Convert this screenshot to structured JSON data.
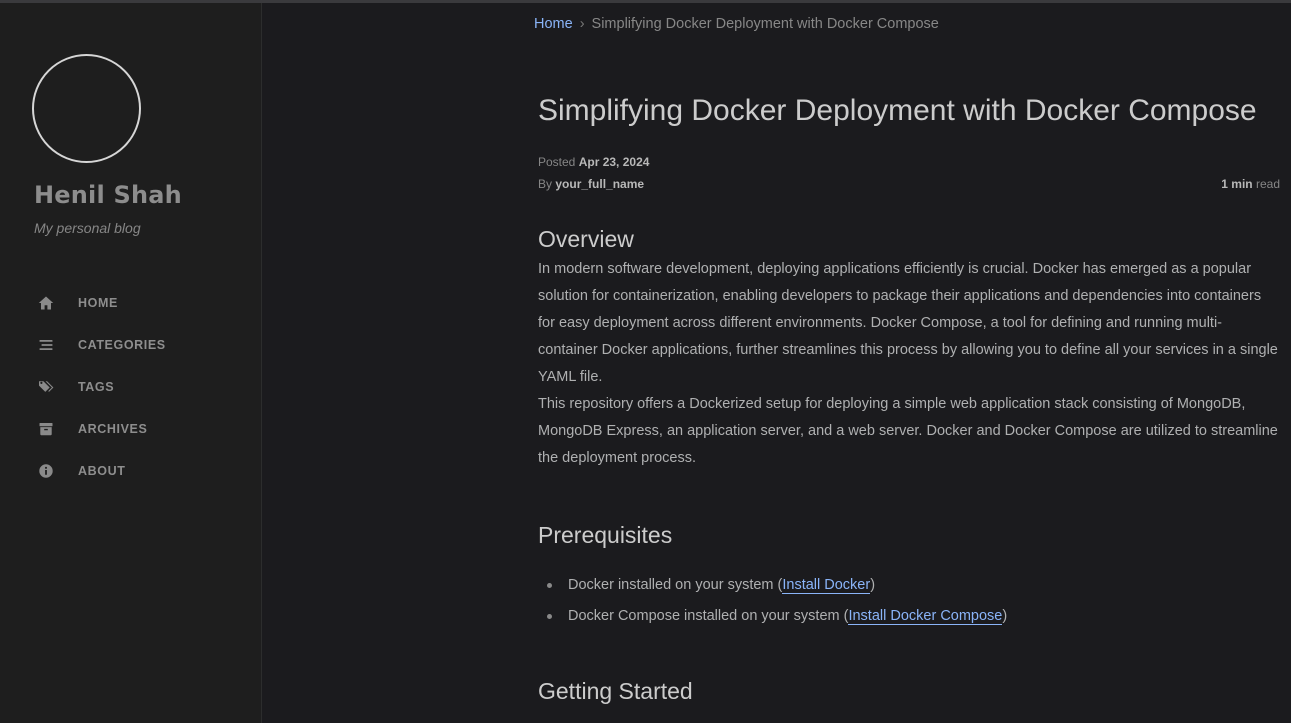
{
  "sidebar": {
    "site_title": "Henil Shah",
    "site_subtitle": "My personal blog",
    "nav": [
      {
        "label": "HOME",
        "icon": "home-icon"
      },
      {
        "label": "CATEGORIES",
        "icon": "stream-icon"
      },
      {
        "label": "TAGS",
        "icon": "tags-icon"
      },
      {
        "label": "ARCHIVES",
        "icon": "archive-icon"
      },
      {
        "label": "ABOUT",
        "icon": "info-circle-icon"
      }
    ]
  },
  "breadcrumb": {
    "home": "Home",
    "separator": "›",
    "current": "Simplifying Docker Deployment with Docker Compose"
  },
  "post": {
    "title": "Simplifying Docker Deployment with Docker Compose",
    "posted_label": "Posted",
    "posted_date": "Apr 23, 2024",
    "by_label": "By",
    "author": "your_full_name",
    "read_value": "1 min",
    "read_label": "read"
  },
  "sections": {
    "overview": {
      "heading": "Overview",
      "p1": "In modern software development, deploying applications efficiently is crucial. Docker has emerged as a popular solution for containerization, enabling developers to package their applications and dependencies into containers for easy deployment across different environments. Docker Compose, a tool for defining and running multi-container Docker applications, further streamlines this process by allowing you to define all your services in a single YAML file.",
      "p2": "This repository offers a Dockerized setup for deploying a simple web application stack consisting of MongoDB, MongoDB Express, an application server, and a web server. Docker and Docker Compose are utilized to streamline the deployment process."
    },
    "prerequisites": {
      "heading": "Prerequisites",
      "items": [
        {
          "text": "Docker installed on your system (",
          "link": "Install Docker",
          "after": ")"
        },
        {
          "text": "Docker Compose installed on your system (",
          "link": "Install Docker Compose",
          "after": ")"
        }
      ]
    },
    "getting_started": {
      "heading": "Getting Started"
    }
  },
  "colors": {
    "background": "#1b1b1e",
    "sidebar": "#1e1e1e",
    "link": "#8ab4f8",
    "heading": "#cccccc",
    "text": "#afb0b1"
  }
}
